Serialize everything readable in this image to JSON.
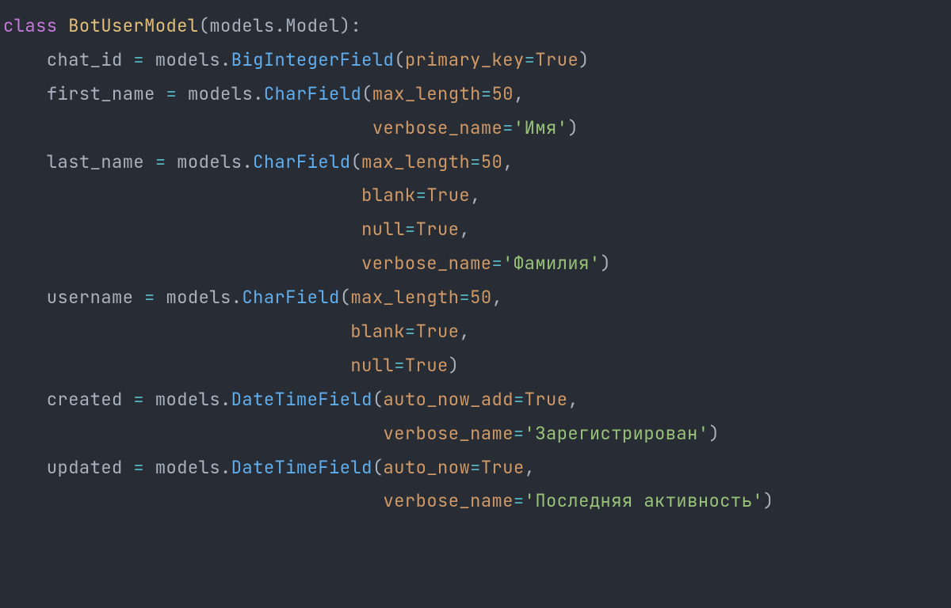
{
  "code": {
    "language": "python",
    "class_keyword": "class",
    "class_name": "BotUserModel",
    "base_module": "models",
    "base_class": "Model",
    "fields": [
      {
        "name": "chat_id",
        "module": "models",
        "call": "BigIntegerField",
        "args": [
          {
            "kw": "primary_key",
            "value_type": "bool",
            "value": "True"
          }
        ]
      },
      {
        "name": "first_name",
        "module": "models",
        "call": "CharField",
        "args": [
          {
            "kw": "max_length",
            "value_type": "num",
            "value": "50"
          },
          {
            "kw": "verbose_name",
            "value_type": "str",
            "value": "'Имя'"
          }
        ]
      },
      {
        "name": "last_name",
        "module": "models",
        "call": "CharField",
        "args": [
          {
            "kw": "max_length",
            "value_type": "num",
            "value": "50"
          },
          {
            "kw": "blank",
            "value_type": "bool",
            "value": "True"
          },
          {
            "kw": "null",
            "value_type": "bool",
            "value": "True"
          },
          {
            "kw": "verbose_name",
            "value_type": "str",
            "value": "'Фамилия'"
          }
        ]
      },
      {
        "name": "username",
        "module": "models",
        "call": "CharField",
        "args": [
          {
            "kw": "max_length",
            "value_type": "num",
            "value": "50"
          },
          {
            "kw": "blank",
            "value_type": "bool",
            "value": "True"
          },
          {
            "kw": "null",
            "value_type": "bool",
            "value": "True"
          }
        ]
      },
      {
        "name": "created",
        "module": "models",
        "call": "DateTimeField",
        "args": [
          {
            "kw": "auto_now_add",
            "value_type": "bool",
            "value": "True"
          },
          {
            "kw": "verbose_name",
            "value_type": "str",
            "value": "'Зарегистрирован'"
          }
        ]
      },
      {
        "name": "updated",
        "module": "models",
        "call": "DateTimeField",
        "args": [
          {
            "kw": "auto_now",
            "value_type": "bool",
            "value": "True"
          },
          {
            "kw": "verbose_name",
            "value_type": "str",
            "value": "'Последняя активность'"
          }
        ]
      }
    ]
  }
}
